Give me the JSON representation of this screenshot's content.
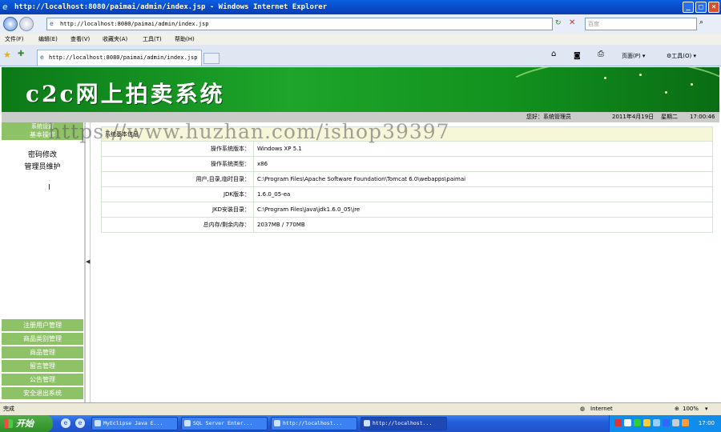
{
  "window": {
    "title": "http://localhost:8080/paimai/admin/index.jsp - Windows Internet Explorer",
    "min_icon": "minimize-icon",
    "max_icon": "maximize-icon",
    "close_icon": "close-icon"
  },
  "address_bar": {
    "url": "http://localhost:8080/paimai/admin/index.jsp",
    "search_placeholder": "百度"
  },
  "menu": [
    "文件(F)",
    "编辑(E)",
    "查看(V)",
    "收藏夹(A)",
    "工具(T)",
    "帮助(H)"
  ],
  "tab": {
    "label": "http://localhost:8080/paimai/admin/index.jsp"
  },
  "toolbar": {
    "page_label": "页面(P)",
    "tools_label": "工具(O)"
  },
  "banner": {
    "title": "c2c网上拍卖系统"
  },
  "status_strip": {
    "greeting": "您好：系统管理员",
    "date": "2011年4月19日",
    "weekday": "星期二",
    "time": "17:00:46"
  },
  "sidebar": {
    "section_top": "系统设置",
    "section_basic": "基本操作",
    "links": [
      "密码修改",
      "管理员维护"
    ],
    "nav_items": [
      "注册用户管理",
      "商品类别管理",
      "商品管理",
      "留言管理",
      "公告管理",
      "安全退出系统"
    ]
  },
  "info": {
    "header": "系统基本信息",
    "rows": [
      {
        "label": "操作系统版本：",
        "value": "Windows XP  5.1"
      },
      {
        "label": "操作系统类型：",
        "value": "x86"
      },
      {
        "label": "用户,目录,临时目录：",
        "value": "C:\\Program Files\\Apache Software Foundation\\Tomcat 6.0\\webapps\\paimai"
      },
      {
        "label": "JDK版本：",
        "value": "1.6.0_05-ea"
      },
      {
        "label": "JKD安装目录：",
        "value": "C:\\Program Files\\Java\\jdk1.6.0_05\\jre"
      },
      {
        "label": "总内存/剩余内存：",
        "value": "2037MB  /  770MB"
      }
    ]
  },
  "watermark": "https://www.huzhan.com/ishop39397",
  "ie_status": {
    "left": "完成",
    "zone": "Internet",
    "zoom": "100%"
  },
  "taskbar": {
    "start": "开始",
    "tasks": [
      "MyEclipse Java E...",
      "SQL Server Enter...",
      "http://localhost...",
      "http://localhost..."
    ],
    "clock": "17:00"
  },
  "colors": {
    "banner_green": "#1ea52a",
    "sidebar_green": "#8ec266",
    "ie_blue": "#0949c6"
  }
}
